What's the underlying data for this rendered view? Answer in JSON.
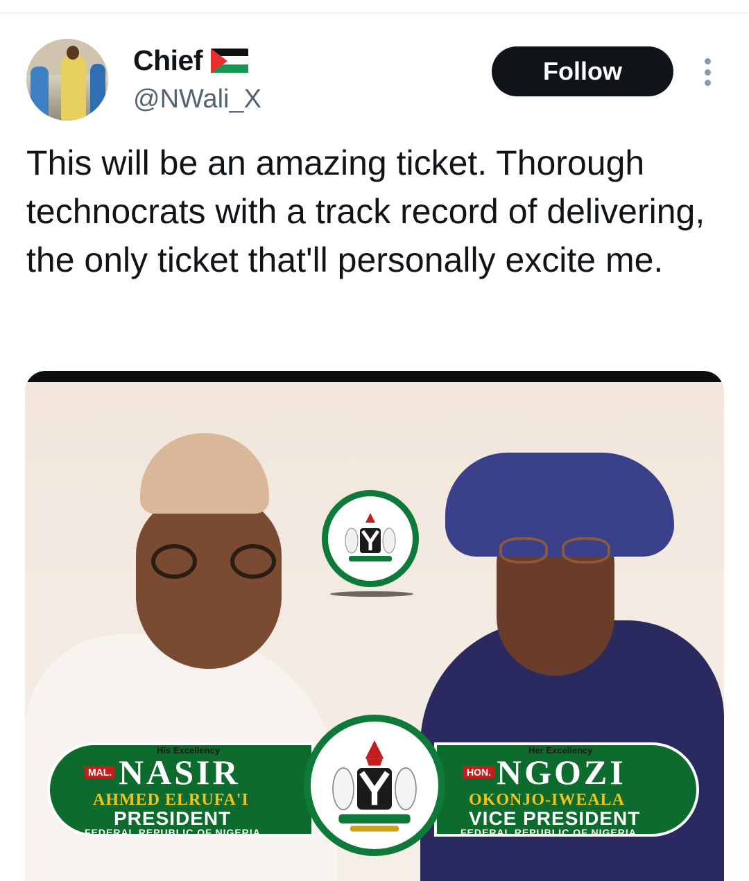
{
  "user": {
    "display_name": "Chief",
    "handle": "@NWali_X",
    "flag_icon": "palestine-flag-icon"
  },
  "actions": {
    "follow_label": "Follow",
    "more_icon": "more-vertical-icon"
  },
  "tweet": {
    "text": "This will be an amazing ticket. Thorough technocrats with a track record of delivering, the only ticket that'll personally excite me."
  },
  "poster": {
    "left": {
      "excellency": "His Excellency",
      "title": "MAL.",
      "first_name": "NASIR",
      "surname": "AHMED ELRUFA'I",
      "role": "PRESIDENT",
      "country": "FEDERAL REPUBLIC OF NIGERIA"
    },
    "right": {
      "excellency": "Her Excellency",
      "title": "HON.",
      "first_name": "NGOZI",
      "surname": "OKONJO-IWEALA",
      "role": "VICE PRESIDENT",
      "country": "FEDERAL REPUBLIC OF NIGERIA"
    },
    "colors": {
      "green": "#0d6b2e",
      "gold": "#f3c316",
      "red": "#c41d1d",
      "background": "#f3e8de"
    }
  }
}
